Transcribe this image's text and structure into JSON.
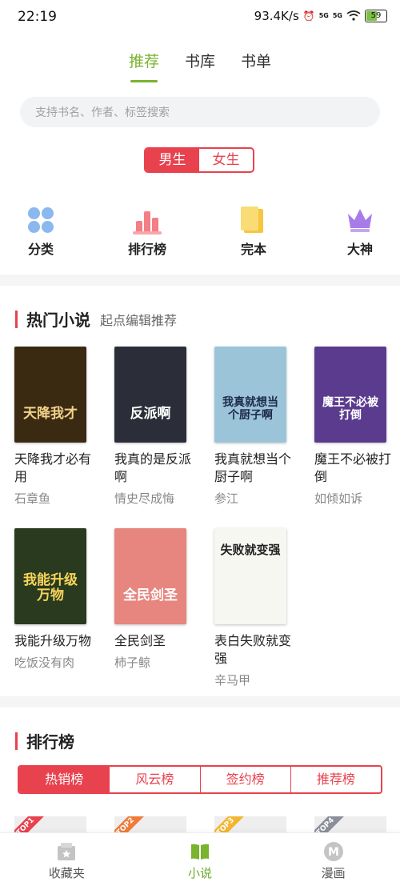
{
  "status_bar": {
    "time": "22:19",
    "speed": "93.4K/s",
    "battery": "59",
    "battery_level": 0.59,
    "signal1": "5G",
    "signal2": "5G"
  },
  "top_tabs": [
    {
      "label": "推荐",
      "active": true
    },
    {
      "label": "书库",
      "active": false
    },
    {
      "label": "书单",
      "active": false
    }
  ],
  "search": {
    "placeholder": "支持书名、作者、标签搜索"
  },
  "gender": {
    "male": "男生",
    "female": "女生",
    "selected": "male"
  },
  "shortcuts": [
    {
      "label": "分类",
      "icon": "category-dots-icon"
    },
    {
      "label": "排行榜",
      "icon": "ranking-bars-icon"
    },
    {
      "label": "完本",
      "icon": "finished-book-icon"
    },
    {
      "label": "大神",
      "icon": "crown-icon"
    }
  ],
  "hot_novels": {
    "title": "热门小说",
    "subtitle": "起点编辑推荐",
    "books": [
      {
        "title": "天降我才必有用",
        "author": "石章鱼",
        "cover_text": "天降我才",
        "cover_bg": "#3a2a12",
        "cover_color": "#f2d28a"
      },
      {
        "title": "我真的是反派啊",
        "author": "情史尽成悔",
        "cover_text": "反派啊",
        "cover_bg": "#2b2e38",
        "cover_color": "#ffffff"
      },
      {
        "title": "我真就想当个厨子啊",
        "author": "参江",
        "cover_text": "我真就想当个厨子啊",
        "cover_bg": "#9cc4d8",
        "cover_color": "#1d2a4a"
      },
      {
        "title": "魔王不必被打倒",
        "author": "如倾如诉",
        "cover_text": "魔王不必被打倒",
        "cover_bg": "#5a3b8e",
        "cover_color": "#ffffff"
      },
      {
        "title": "我能升级万物",
        "author": "吃饭没有肉",
        "cover_text": "我能升级万物",
        "cover_bg": "#2a3a1e",
        "cover_color": "#f6d45a"
      },
      {
        "title": "全民剑圣",
        "author": "柿子鲸",
        "cover_text": "全民剑圣",
        "cover_bg": "#e7857f",
        "cover_color": "#ffffff"
      },
      {
        "title": "表白失败就变强",
        "author": "辛马甲",
        "cover_text": "失败就变强",
        "cover_bg": "#f7f7f2",
        "cover_color": "#222222"
      }
    ]
  },
  "ranking": {
    "title": "排行榜",
    "tabs": [
      {
        "label": "热销榜",
        "active": true
      },
      {
        "label": "风云榜",
        "active": false
      },
      {
        "label": "签约榜",
        "active": false
      },
      {
        "label": "推荐榜",
        "active": false
      }
    ],
    "top_labels": [
      "TOP1",
      "TOP2",
      "TOP3",
      "TOP4"
    ],
    "top_colors": [
      "#e8424f",
      "#f07b3a",
      "#f2b632",
      "#8a8f99"
    ]
  },
  "bottom_nav": [
    {
      "label": "收藏夹",
      "icon": "bookshelf-icon",
      "active": false
    },
    {
      "label": "小说",
      "icon": "open-book-icon",
      "active": true
    },
    {
      "label": "漫画",
      "icon": "comic-m-icon",
      "active": false
    }
  ],
  "colors": {
    "accent_green": "#7ab32e",
    "accent_red": "#e8424f"
  }
}
